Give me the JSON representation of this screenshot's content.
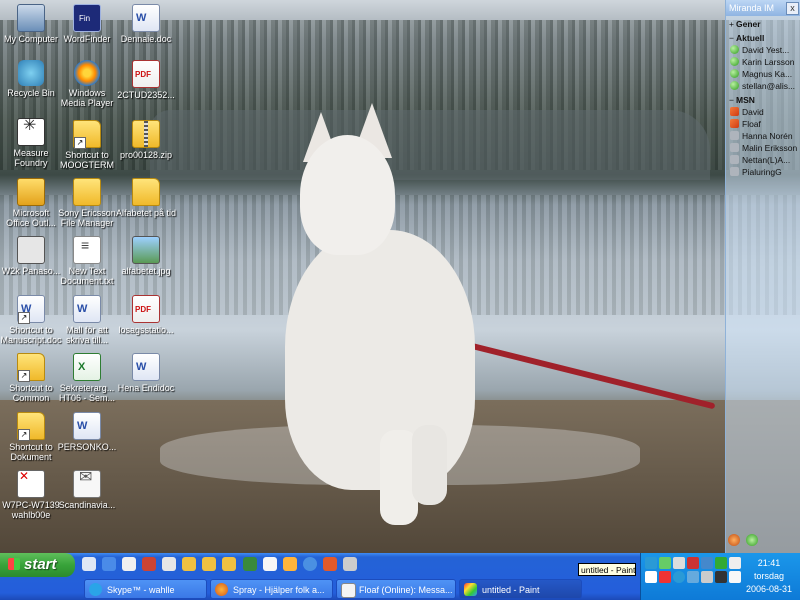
{
  "desktop_icons": [
    {
      "label": "My Computer",
      "icon": "computer-icon"
    },
    {
      "label": "WordFinder",
      "icon": "wordfinder-icon"
    },
    {
      "label": "Dennaie.doc",
      "icon": "word-document-icon"
    },
    {
      "label": "Recycle Bin",
      "icon": "recycle-bin-icon"
    },
    {
      "label": "Windows Media Player",
      "icon": "media-player-icon"
    },
    {
      "label": "2CTUD2352...",
      "icon": "pdf-icon"
    },
    {
      "label": "Measure Foundry",
      "icon": "measure-foundry-icon"
    },
    {
      "label": "Shortcut to MOOGTERM",
      "icon": "folder-shortcut-icon"
    },
    {
      "label": "pro00128.zip",
      "icon": "zip-icon"
    },
    {
      "label": "Microsoft Office Outl...",
      "icon": "outlook-icon"
    },
    {
      "label": "Sony Ericsson File Manager",
      "icon": "sony-ericsson-icon"
    },
    {
      "label": "Alfabetet på tid",
      "icon": "folder-icon"
    },
    {
      "label": "W2k Panaso...",
      "icon": "w2k-icon"
    },
    {
      "label": "New Text Document.txt",
      "icon": "text-document-icon"
    },
    {
      "label": "alfabetet.jpg",
      "icon": "image-icon"
    },
    {
      "label": "Shortcut to Manuscript.doc",
      "icon": "word-shortcut-icon"
    },
    {
      "label": "Mall för att skriva till...",
      "icon": "word-document-icon"
    },
    {
      "label": "losagsstatio...",
      "icon": "pdf-icon"
    },
    {
      "label": "Shortcut to Common",
      "icon": "folder-shortcut-icon"
    },
    {
      "label": "Sekreterarg... HT06 - Sem...",
      "icon": "excel-icon"
    },
    {
      "label": "Hena Endidoc",
      "icon": "word-document-icon"
    },
    {
      "label": "Shortcut to Dokument",
      "icon": "folder-shortcut-icon"
    },
    {
      "label": "PERSONKO...",
      "icon": "word-document-icon"
    },
    {
      "label": "W7PC-W7139 wahlb00e",
      "icon": "w7pc-icon"
    },
    {
      "label": "Scandinavia...",
      "icon": "envelope-icon"
    }
  ],
  "miranda": {
    "title": "Miranda IM",
    "close_label": "x",
    "groups": [
      {
        "name": "Gener",
        "toggle": "+",
        "contacts": []
      },
      {
        "name": "Aktuell",
        "toggle": "−",
        "contacts": [
          {
            "name": "David Yest...",
            "status": "online"
          },
          {
            "name": "Karin Larsson",
            "status": "online"
          },
          {
            "name": "Magnus Ka...",
            "status": "online"
          },
          {
            "name": "stellan@alis...",
            "status": "online"
          }
        ]
      },
      {
        "name": "MSN",
        "toggle": "−",
        "contacts": [
          {
            "name": "David",
            "status": "msn"
          },
          {
            "name": "Floaf",
            "status": "msn"
          },
          {
            "name": "Hanna Norén",
            "status": "offline"
          },
          {
            "name": "Malin Eriksson",
            "status": "offline"
          },
          {
            "name": "Nettan(L)A...",
            "status": "offline"
          },
          {
            "name": "PialuringG",
            "status": "offline"
          }
        ]
      }
    ]
  },
  "taskbar": {
    "start_label": "start",
    "buttons": [
      {
        "label": "Skype™ - wahlle",
        "icon": "skype-icon",
        "active": false
      },
      {
        "label": "Spray - Hjälper folk a...",
        "icon": "firefox-icon",
        "active": false
      },
      {
        "label": "Floaf (Online): Messa...",
        "icon": "message-window-icon",
        "active": false
      },
      {
        "label": "untitled - Paint",
        "icon": "paint-icon",
        "active": true
      }
    ],
    "tooltip": "untitled - Paint",
    "clock": {
      "time": "21:41",
      "day": "torsdag",
      "date": "2006-08-31"
    }
  },
  "colors": {
    "taskbar_blue": "#245edb",
    "start_green": "#38a33a",
    "tray_blue": "#0e7ad7",
    "online_green": "#2e9a1e",
    "msn_orange": "#cf3a12",
    "leash_red": "#a0212a"
  }
}
